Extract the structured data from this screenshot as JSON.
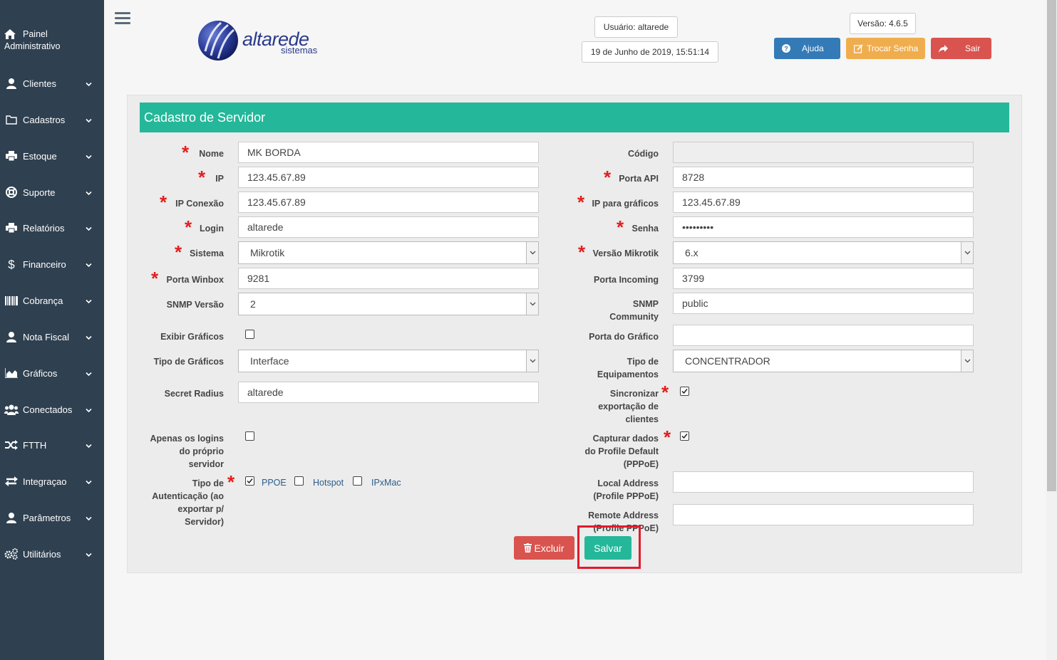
{
  "sidebar": {
    "top": {
      "label_line1": "Painel",
      "label_line2": "Administrativo",
      "icon": "home-icon"
    },
    "items": [
      {
        "label": "Clientes",
        "icon": "user-icon"
      },
      {
        "label": "Cadastros",
        "icon": "folder-icon"
      },
      {
        "label": "Estoque",
        "icon": "print-icon"
      },
      {
        "label": "Suporte",
        "icon": "lifebuoy-icon"
      },
      {
        "label": "Relatórios",
        "icon": "print-icon"
      },
      {
        "label": "Financeiro",
        "icon": "dollar-icon"
      },
      {
        "label": "Cobrança",
        "icon": "barcode-icon"
      },
      {
        "label": "Nota Fiscal",
        "icon": "user-icon"
      },
      {
        "label": "Gráficos",
        "icon": "area-chart-icon"
      },
      {
        "label": "Conectados",
        "icon": "users-icon"
      },
      {
        "label": "FTTH",
        "icon": "shuffle-icon"
      },
      {
        "label": "Integraçao",
        "icon": "exchange-icon"
      },
      {
        "label": "Parâmetros",
        "icon": "user-icon"
      },
      {
        "label": "Utilitários",
        "icon": "cogs-icon"
      }
    ]
  },
  "header": {
    "logo_text": "altarede",
    "logo_sub": "sistemas",
    "user": "Usuário: altarede",
    "datetime": "19 de Junho de 2019, 15:51:14",
    "version": "Versão: 4.6.5",
    "help_label": "Ajuda",
    "change_password_label": "Trocar Senha",
    "logout_label": "Sair",
    "colors": {
      "help": "#337ab7",
      "change_password": "#f0ad4e",
      "logout": "#d9534f"
    }
  },
  "form": {
    "title": "Cadastro de Servidor",
    "left": {
      "nome": {
        "label": "Nome",
        "value": "MK BORDA"
      },
      "ip": {
        "label": "IP",
        "value": "123.45.67.89"
      },
      "ip_conexao": {
        "label": "IP Conexão",
        "value": "123.45.67.89"
      },
      "login": {
        "label": "Login",
        "value": "altarede"
      },
      "sistema": {
        "label": "Sistema",
        "value": "Mikrotik"
      },
      "porta_winbox": {
        "label": "Porta Winbox",
        "value": "9281"
      },
      "snmp_versao": {
        "label": "SNMP Versão",
        "value": "2"
      },
      "exibir_graficos": {
        "label": "Exibir Gráficos",
        "checked": false
      },
      "tipo_graficos": {
        "label": "Tipo de Gráficos",
        "value": "Interface"
      },
      "secret_radius": {
        "label": "Secret Radius",
        "value": "altarede"
      },
      "apenas_logins": {
        "label_lines": [
          "Apenas os logins",
          "do próprio",
          "servidor"
        ],
        "checked": false
      },
      "tipo_autenticacao": {
        "label_lines": [
          "Tipo de",
          "Autenticação (ao",
          "exportar p/",
          "Servidor)"
        ],
        "options": [
          {
            "label": "PPOE",
            "checked": true
          },
          {
            "label": "Hotspot",
            "checked": false
          },
          {
            "label": "IPxMac",
            "checked": false
          }
        ]
      }
    },
    "right": {
      "codigo": {
        "label": "Código",
        "value": ""
      },
      "porta_api": {
        "label": "Porta API",
        "value": "8728"
      },
      "ip_graficos": {
        "label": "IP para gráficos",
        "value": "123.45.67.89"
      },
      "senha": {
        "label": "Senha",
        "value": "•••••••••"
      },
      "versao_mikrotik": {
        "label": "Versão Mikrotik",
        "value": "6.x"
      },
      "porta_incoming": {
        "label": "Porta Incoming",
        "value": "3799"
      },
      "snmp_community": {
        "label_lines": [
          "SNMP",
          "Community"
        ],
        "value": "public"
      },
      "porta_grafico": {
        "label": "Porta do Gráfico",
        "value": ""
      },
      "tipo_equipamentos": {
        "label_lines": [
          "Tipo de",
          "Equipamentos"
        ],
        "value": "CONCENTRADOR"
      },
      "sincronizar": {
        "label_lines": [
          "Sincronizar",
          "exportação de",
          "clientes"
        ],
        "checked": true
      },
      "capturar": {
        "label_lines": [
          "Capturar dados",
          "do Profile Default",
          "(PPPoE)"
        ],
        "checked": true
      },
      "local_address": {
        "label_lines": [
          "Local Address",
          "(Profile PPPoE)"
        ],
        "value": ""
      },
      "remote_address": {
        "label_lines": [
          "Remote Address",
          "(Profile PPPoE)"
        ],
        "value": ""
      }
    },
    "delete_label": "Excluir",
    "save_label": "Salvar",
    "colors": {
      "title_bar": "#25b79a",
      "delete": "#d9534f",
      "save": "#25b79a",
      "required": "#e21e1e",
      "highlight": "#e01b2c"
    }
  }
}
